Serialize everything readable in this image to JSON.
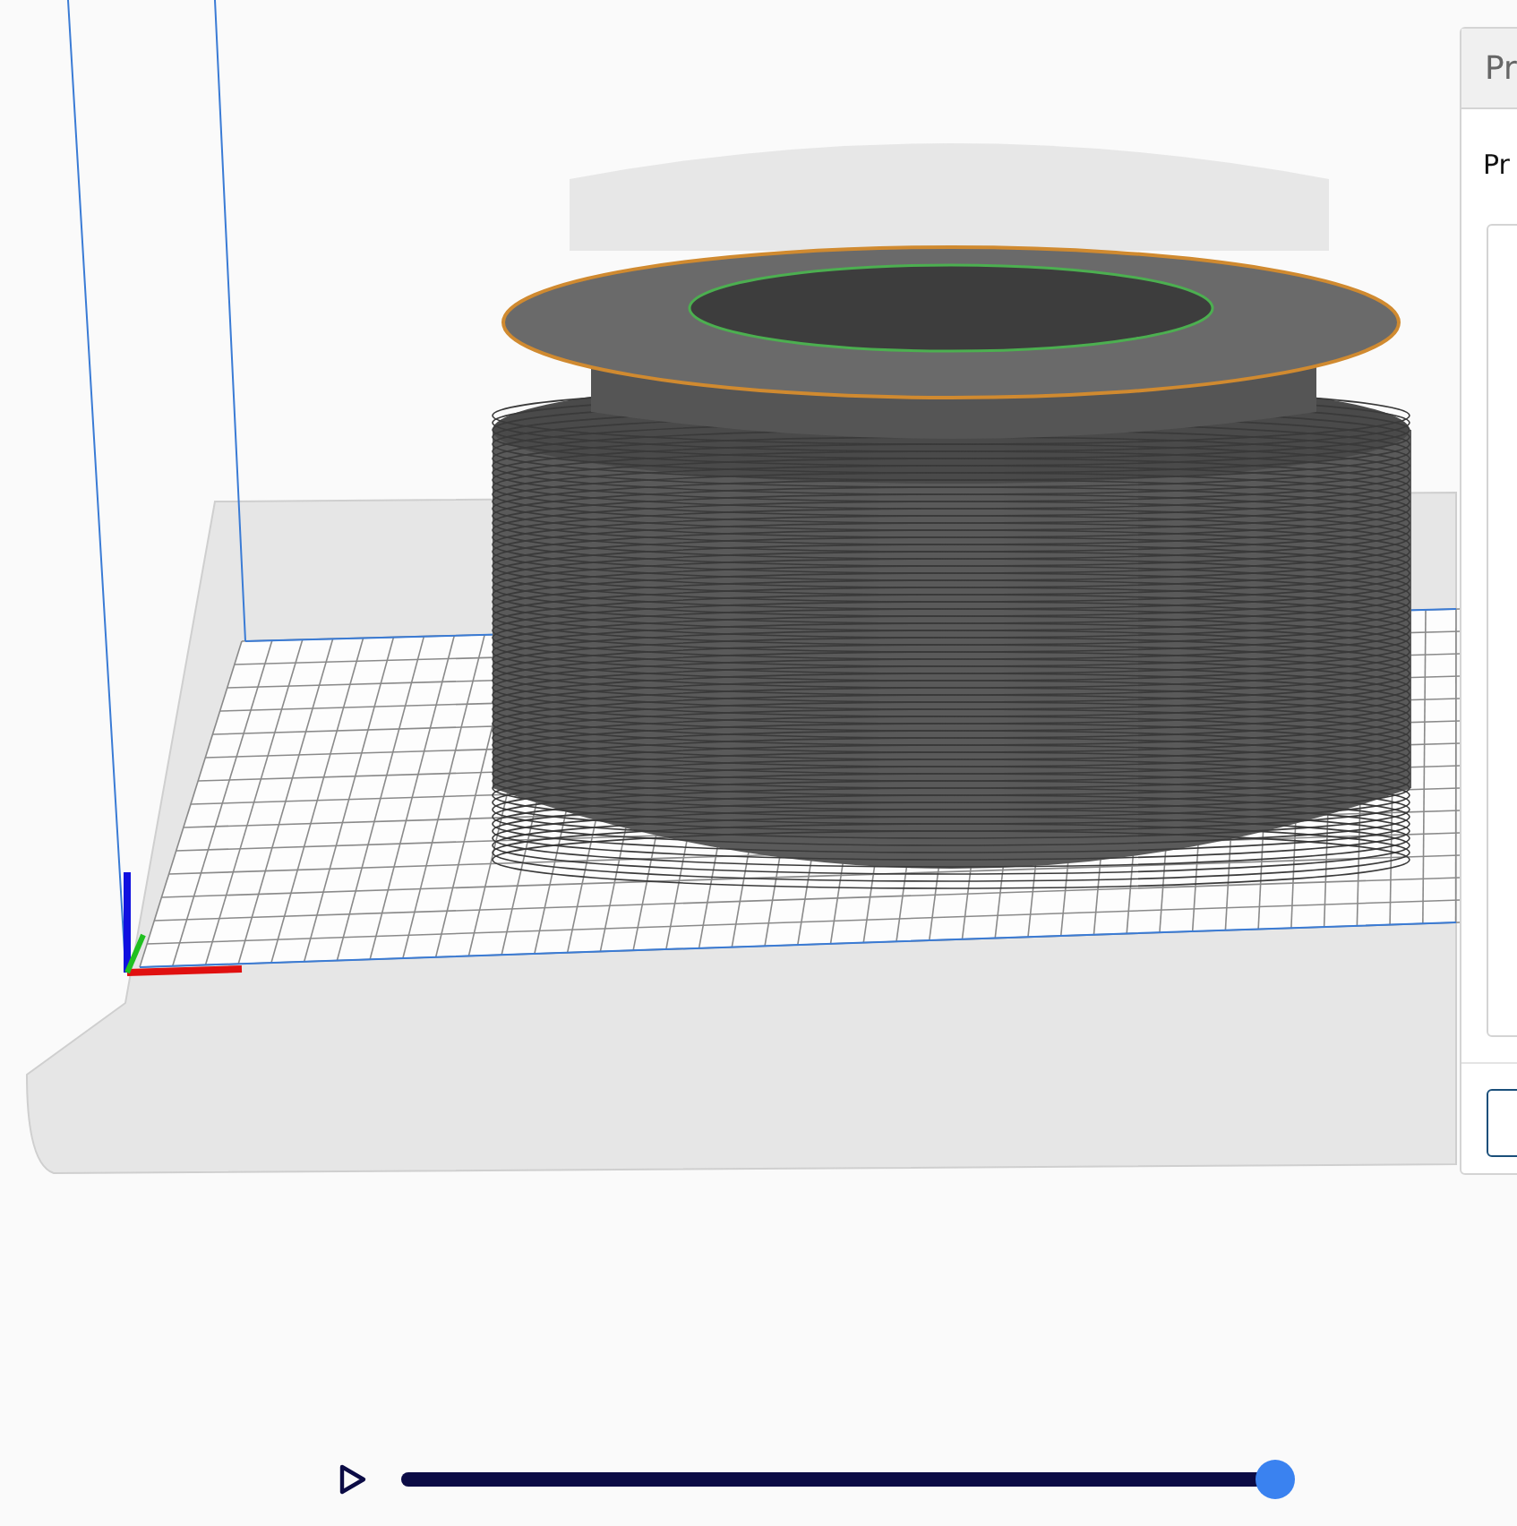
{
  "panel": {
    "tab": "Pr",
    "title": "Pr"
  },
  "playback": {
    "level": 1
  }
}
